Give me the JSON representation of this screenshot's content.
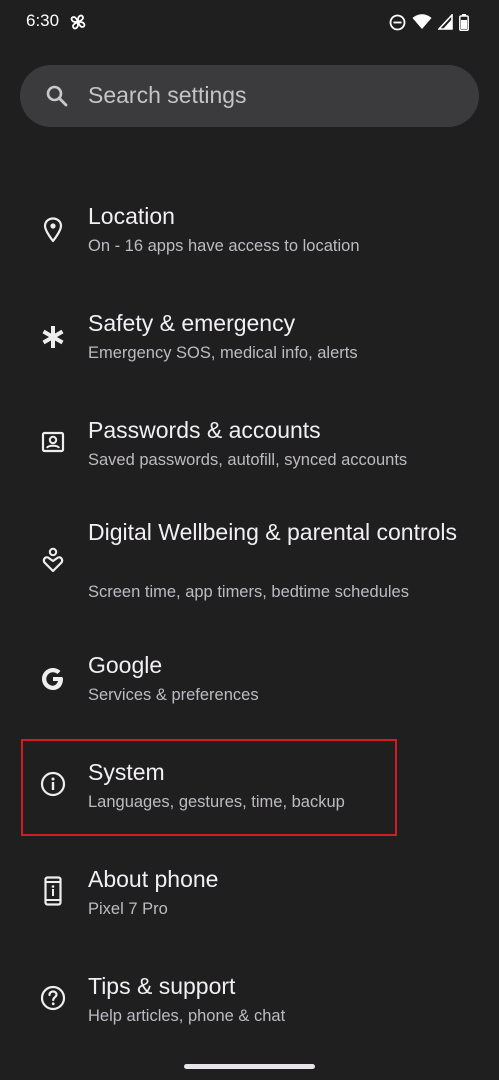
{
  "status_bar": {
    "time": "6:30",
    "icons": [
      "fan-icon",
      "do-not-disturb-icon",
      "wifi-icon",
      "cellular-signal-icon",
      "battery-icon"
    ]
  },
  "search": {
    "placeholder": "Search settings",
    "icon": "search-icon"
  },
  "settings": [
    {
      "key": "location",
      "icon": "location-pin-icon",
      "title": "Location",
      "subtitle": "On - 16 apps have access to location"
    },
    {
      "key": "safety-emergency",
      "icon": "asterisk-icon",
      "title": "Safety & emergency",
      "subtitle": "Emergency SOS, medical info, alerts"
    },
    {
      "key": "passwords-accounts",
      "icon": "account-box-icon",
      "title": "Passwords & accounts",
      "subtitle": "Saved passwords, autofill, synced accounts"
    },
    {
      "key": "digital-wellbeing",
      "icon": "wellbeing-icon",
      "title": "Digital Wellbeing & parental controls",
      "subtitle": "Screen time, app timers, bedtime schedules"
    },
    {
      "key": "google",
      "icon": "google-g-icon",
      "title": "Google",
      "subtitle": "Services & preferences"
    },
    {
      "key": "system",
      "icon": "info-icon",
      "title": "System",
      "subtitle": "Languages, gestures, time, backup"
    },
    {
      "key": "about-phone",
      "icon": "phone-info-icon",
      "title": "About phone",
      "subtitle": "Pixel 7 Pro"
    },
    {
      "key": "tips-support",
      "icon": "help-icon",
      "title": "Tips & support",
      "subtitle": "Help articles, phone & chat"
    }
  ],
  "highlighted_item": "system",
  "colors": {
    "background": "#1f1f20",
    "search_bar": "#3b3b3d",
    "highlight_border": "#d21b22",
    "title_text": "#f1eff3",
    "subtitle_text": "#bdbbc0"
  }
}
